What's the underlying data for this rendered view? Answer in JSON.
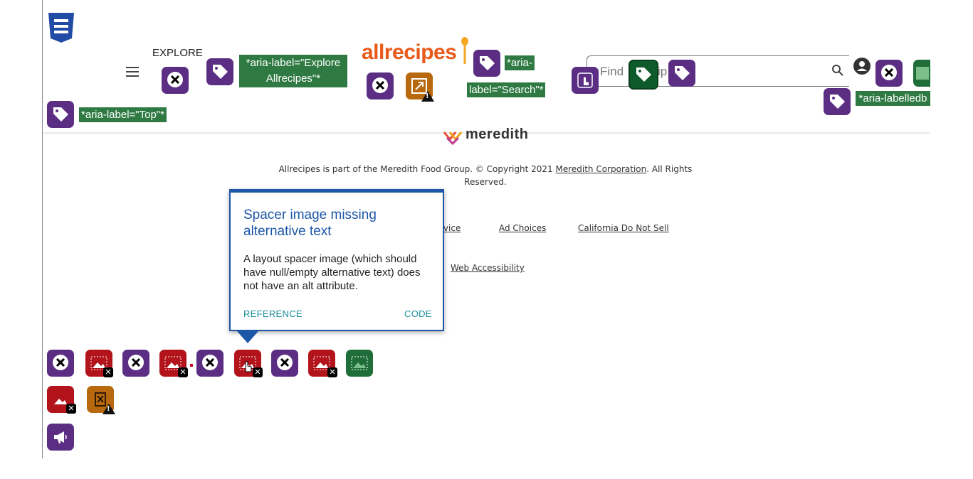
{
  "header": {
    "explore_label": "EXPLORE",
    "logo_text": "allrecipes",
    "search_placeholder": "Find",
    "search_placeholder_tail": "ip"
  },
  "aria_labels": {
    "explore": "*aria-label=\"Explore Allrecipes\"*",
    "search_line1": "*aria-",
    "search_line2": "label=\"Search\"*",
    "labelledby": "*aria-labelledb",
    "top": "*aria-label=\"Top\"*"
  },
  "footer": {
    "brand": "meredith",
    "copyright_prefix": "Allrecipes is part of the Meredith Food Group. © Copyright 2021 ",
    "copyright_link": "Meredith Corporation",
    "copyright_suffix": ". All Rights Reserved.",
    "links": {
      "service_fragment": "rvice",
      "ad_choices": "Ad Choices",
      "do_not_sell": "California Do Not Sell",
      "web_accessibility": "Web Accessibility"
    }
  },
  "popup": {
    "title": "Spacer image missing alternative text",
    "body": "A layout spacer image (which should have null/empty alternative text) does not have an alt attribute.",
    "reference_label": "REFERENCE",
    "code_label": "CODE"
  },
  "colors": {
    "wave_purple": "#5b2e84",
    "wave_green": "#2f7a43",
    "wave_red": "#b3141c",
    "wave_orange": "#b8690e",
    "popup_blue": "#1d57a8",
    "logo_orange": "#e8591a"
  },
  "icons": {
    "css": "css3-icon",
    "menu": "hamburger-menu-icon",
    "error": "error-x-icon",
    "aria": "aria-tag-icon",
    "alert": "alert-warning-icon",
    "search": "search-icon",
    "user": "user-account-icon",
    "image": "image-icon",
    "spacer": "spacer-image-icon",
    "handpointer": "tabindex-hand-icon",
    "megaphone": "aria-live-megaphone-icon"
  }
}
